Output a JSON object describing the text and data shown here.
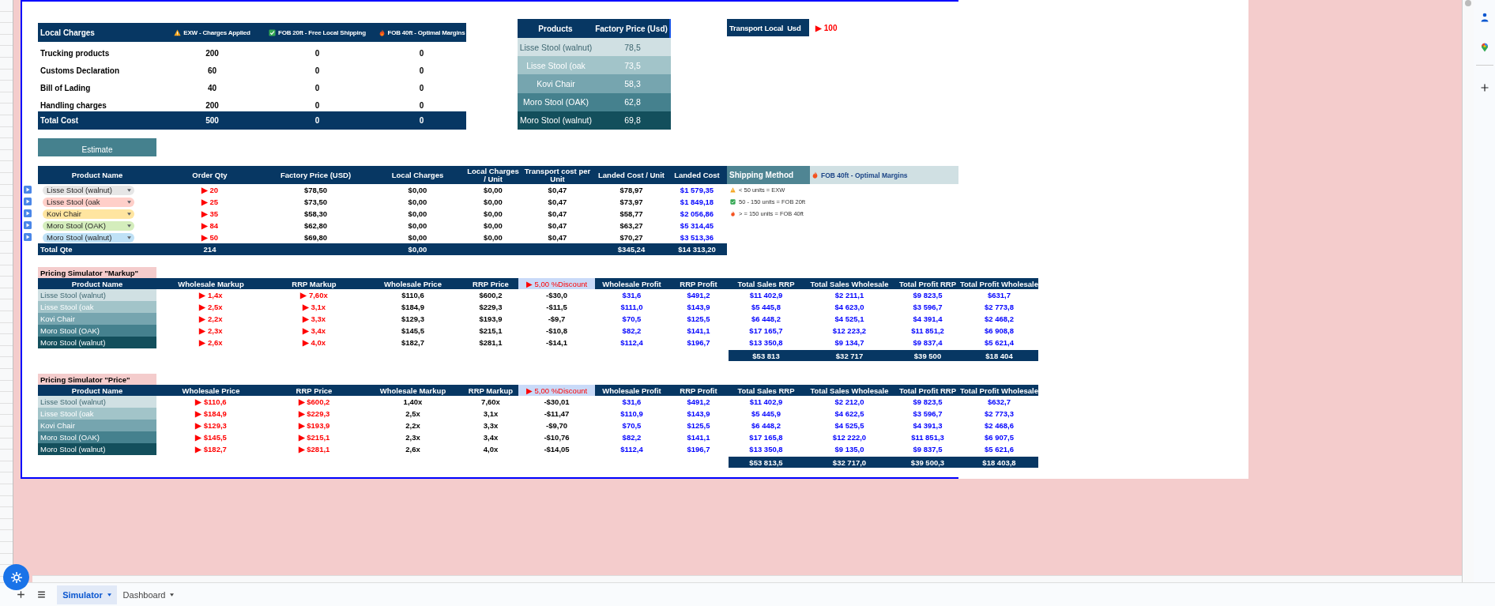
{
  "local_charges": {
    "columns": [
      {
        "label": "Local Charges",
        "kind": "title"
      },
      {
        "label": "EXW - Charges Applied",
        "kind": "warning"
      },
      {
        "label": "FOB 20ft - Free Local Shipping",
        "kind": "check"
      },
      {
        "label": "FOB 40ft - Optimal Margins",
        "kind": "fire"
      }
    ],
    "rows": [
      {
        "cells": [
          "Trucking products",
          "200",
          "0",
          "0"
        ]
      },
      {
        "cells": [
          "Customs Declaration",
          "60",
          "0",
          "0"
        ]
      },
      {
        "cells": [
          "Bill of Lading",
          "40",
          "0",
          "0"
        ]
      },
      {
        "cells": [
          "Handling charges",
          "200",
          "0",
          "0"
        ]
      }
    ],
    "total": {
      "cells": [
        "Total Cost",
        "500",
        "0",
        "0"
      ]
    }
  },
  "products": {
    "columns": [
      "Products",
      "Factory Price (Usd)"
    ],
    "rows": [
      {
        "cells": [
          "Lisse Stool (walnut)",
          "78,5"
        ]
      },
      {
        "cells": [
          "Lisse Stool (oak",
          "73,5"
        ]
      },
      {
        "cells": [
          "Kovi Chair",
          "58,3"
        ]
      },
      {
        "cells": [
          "Moro Stool (OAK)",
          "62,8"
        ]
      },
      {
        "cells": [
          "Moro Stool (walnut)",
          "69,8"
        ]
      }
    ]
  },
  "transport": {
    "label": "Transport Local  Usd",
    "value": "▶ 100"
  },
  "estimate_button": "Estimate",
  "orders": {
    "columns": [
      {
        "label": "Product Name",
        "kind": "name"
      },
      {
        "label": "Order Qty",
        "kind": "input"
      },
      {
        "label": "Factory Price (USD)",
        "kind": "calc"
      },
      {
        "label": "Local Charges",
        "kind": "calc"
      },
      {
        "label": "Local Charges / Unit",
        "kind": "calc"
      },
      {
        "label": "Transport cost per Unit",
        "kind": "calc"
      },
      {
        "label": "Landed Cost / Unit",
        "kind": "calc"
      },
      {
        "label": "Landed Cost",
        "kind": "result"
      }
    ],
    "rows": [
      {
        "color": "#e6e6e6",
        "cells": [
          "Lisse Stool (walnut)",
          "▶ 20",
          "$78,50",
          "$0,00",
          "$0,00",
          "$0,47",
          "$78,97",
          "$1 579,35"
        ]
      },
      {
        "color": "#ffcfc9",
        "cells": [
          "Lisse Stool (oak",
          "▶ 25",
          "$73,50",
          "$0,00",
          "$0,00",
          "$0,47",
          "$73,97",
          "$1 849,18"
        ]
      },
      {
        "color": "#ffe5a0",
        "cells": [
          "Kovi Chair",
          "▶ 35",
          "$58,30",
          "$0,00",
          "$0,00",
          "$0,47",
          "$58,77",
          "$2 056,86"
        ]
      },
      {
        "color": "#d4edbc",
        "cells": [
          "Moro Stool (OAK)",
          "▶ 84",
          "$62,80",
          "$0,00",
          "$0,00",
          "$0,47",
          "$63,27",
          "$5 314,45"
        ]
      },
      {
        "color": "#bfe1f6",
        "cells": [
          "Moro Stool (walnut)",
          "▶ 50",
          "$69,80",
          "$0,00",
          "$0,00",
          "$0,47",
          "$70,27",
          "$3 513,36"
        ]
      }
    ],
    "total": {
      "label": "Total Qte",
      "qty": "214",
      "local_charges": "$0,00",
      "landed_unit": "$345,24",
      "landed_cost": "$14 313,20"
    }
  },
  "shipping": {
    "label": "Shipping Method",
    "value": "FOB 40ft - Optimal Margins",
    "kind": "fire",
    "legend": [
      {
        "kind": "warning",
        "text": "< 50 units = EXW"
      },
      {
        "kind": "check",
        "text": "50 - 150 units = FOB 20ft"
      },
      {
        "kind": "fire",
        "text": "> = 150 units = FOB 40ft"
      }
    ]
  },
  "simulators": [
    {
      "title": "Pricing Simulator \"Markup\"",
      "columns": [
        {
          "label": "Product Name",
          "kind": "name"
        },
        {
          "label": "Wholesale Markup",
          "kind": "input"
        },
        {
          "label": "RRP Markup",
          "kind": "input"
        },
        {
          "label": "Wholesale Price",
          "kind": "calc"
        },
        {
          "label": "RRP Price",
          "kind": "calc"
        },
        {
          "label": "▶ 5,00 %Discount",
          "kind": "discount"
        },
        {
          "label": "Wholesale Profit",
          "kind": "result"
        },
        {
          "label": "RRP Profit",
          "kind": "result"
        },
        {
          "label": "Total Sales RRP",
          "kind": "result"
        },
        {
          "label": "Total Sales Wholesale",
          "kind": "result"
        },
        {
          "label": "Total Profit RRP",
          "kind": "result"
        },
        {
          "label": "Total Profit Wholesale",
          "kind": "result"
        }
      ],
      "rows": [
        {
          "cells": [
            "Lisse Stool (walnut)",
            "▶ 1,4x",
            "▶ 7,60x",
            "$110,6",
            "$600,2",
            "-$30,0",
            "$31,6",
            "$491,2",
            "$11 402,9",
            "$2 211,1",
            "$9 823,5",
            "$631,7"
          ]
        },
        {
          "cells": [
            "Lisse Stool (oak",
            "▶ 2,5x",
            "▶ 3,1x",
            "$184,9",
            "$229,3",
            "-$11,5",
            "$111,0",
            "$143,9",
            "$5 445,8",
            "$4 623,0",
            "$3 596,7",
            "$2 773,8"
          ]
        },
        {
          "cells": [
            "Kovi Chair",
            "▶ 2,2x",
            "▶ 3,3x",
            "$129,3",
            "$193,9",
            "-$9,7",
            "$70,5",
            "$125,5",
            "$6 448,2",
            "$4 525,1",
            "$4 391,4",
            "$2 468,2"
          ]
        },
        {
          "cells": [
            "Moro Stool (OAK)",
            "▶ 2,3x",
            "▶ 3,4x",
            "$145,5",
            "$215,1",
            "-$10,8",
            "$82,2",
            "$141,1",
            "$17 165,7",
            "$12 223,2",
            "$11 851,2",
            "$6 908,8"
          ]
        },
        {
          "cells": [
            "Moro Stool (walnut)",
            "▶ 2,6x",
            "▶ 4,0x",
            "$182,7",
            "$281,1",
            "-$14,1",
            "$112,4",
            "$196,7",
            "$13 350,8",
            "$9 134,7",
            "$9 837,4",
            "$5 621,4"
          ]
        }
      ],
      "totals": [
        "$53 813",
        "$32 717",
        "$39 500",
        "$18 404"
      ]
    },
    {
      "title": "Pricing Simulator \"Price\"",
      "columns": [
        {
          "label": "Product Name",
          "kind": "name"
        },
        {
          "label": "Wholesale Price",
          "kind": "input"
        },
        {
          "label": "RRP Price",
          "kind": "input"
        },
        {
          "label": "Wholesale Markup",
          "kind": "calc"
        },
        {
          "label": "RRP Markup",
          "kind": "calc"
        },
        {
          "label": "▶ 5,00 %Discount",
          "kind": "discount"
        },
        {
          "label": "Wholesale Profit",
          "kind": "result"
        },
        {
          "label": "RRP Profit",
          "kind": "result"
        },
        {
          "label": "Total Sales RRP",
          "kind": "result"
        },
        {
          "label": "Total Sales Wholesale",
          "kind": "result"
        },
        {
          "label": "Total Profit RRP",
          "kind": "result"
        },
        {
          "label": "Total Profit Wholesale",
          "kind": "result"
        }
      ],
      "rows": [
        {
          "cells": [
            "Lisse Stool (walnut)",
            "▶ $110,6",
            "▶ $600,2",
            "1,40x",
            "7,60x",
            "-$30,01",
            "$31,6",
            "$491,2",
            "$11 402,9",
            "$2 212,0",
            "$9 823,5",
            "$632,7"
          ]
        },
        {
          "cells": [
            "Lisse Stool (oak",
            "▶ $184,9",
            "▶ $229,3",
            "2,5x",
            "3,1x",
            "-$11,47",
            "$110,9",
            "$143,9",
            "$5 445,9",
            "$4 622,5",
            "$3 596,7",
            "$2 773,3"
          ]
        },
        {
          "cells": [
            "Kovi Chair",
            "▶ $129,3",
            "▶ $193,9",
            "2,2x",
            "3,3x",
            "-$9,70",
            "$70,5",
            "$125,5",
            "$6 448,2",
            "$4 525,5",
            "$4 391,3",
            "$2 468,6"
          ]
        },
        {
          "cells": [
            "Moro Stool (OAK)",
            "▶ $145,5",
            "▶ $215,1",
            "2,3x",
            "3,4x",
            "-$10,76",
            "$82,2",
            "$141,1",
            "$17 165,8",
            "$12 222,0",
            "$11 851,3",
            "$6 907,5"
          ]
        },
        {
          "cells": [
            "Moro Stool (walnut)",
            "▶ $182,7",
            "▶ $281,1",
            "2,6x",
            "4,0x",
            "-$14,05",
            "$112,4",
            "$196,7",
            "$13 350,8",
            "$9 135,0",
            "$9 837,5",
            "$5 621,6"
          ]
        }
      ],
      "totals": [
        "$53 813,5",
        "$32 717,0",
        "$39 500,3",
        "$18 403,8"
      ]
    }
  ],
  "sheet_tabs": [
    {
      "label": "Simulator",
      "selected": true
    },
    {
      "label": "Dashboard",
      "selected": false
    }
  ]
}
